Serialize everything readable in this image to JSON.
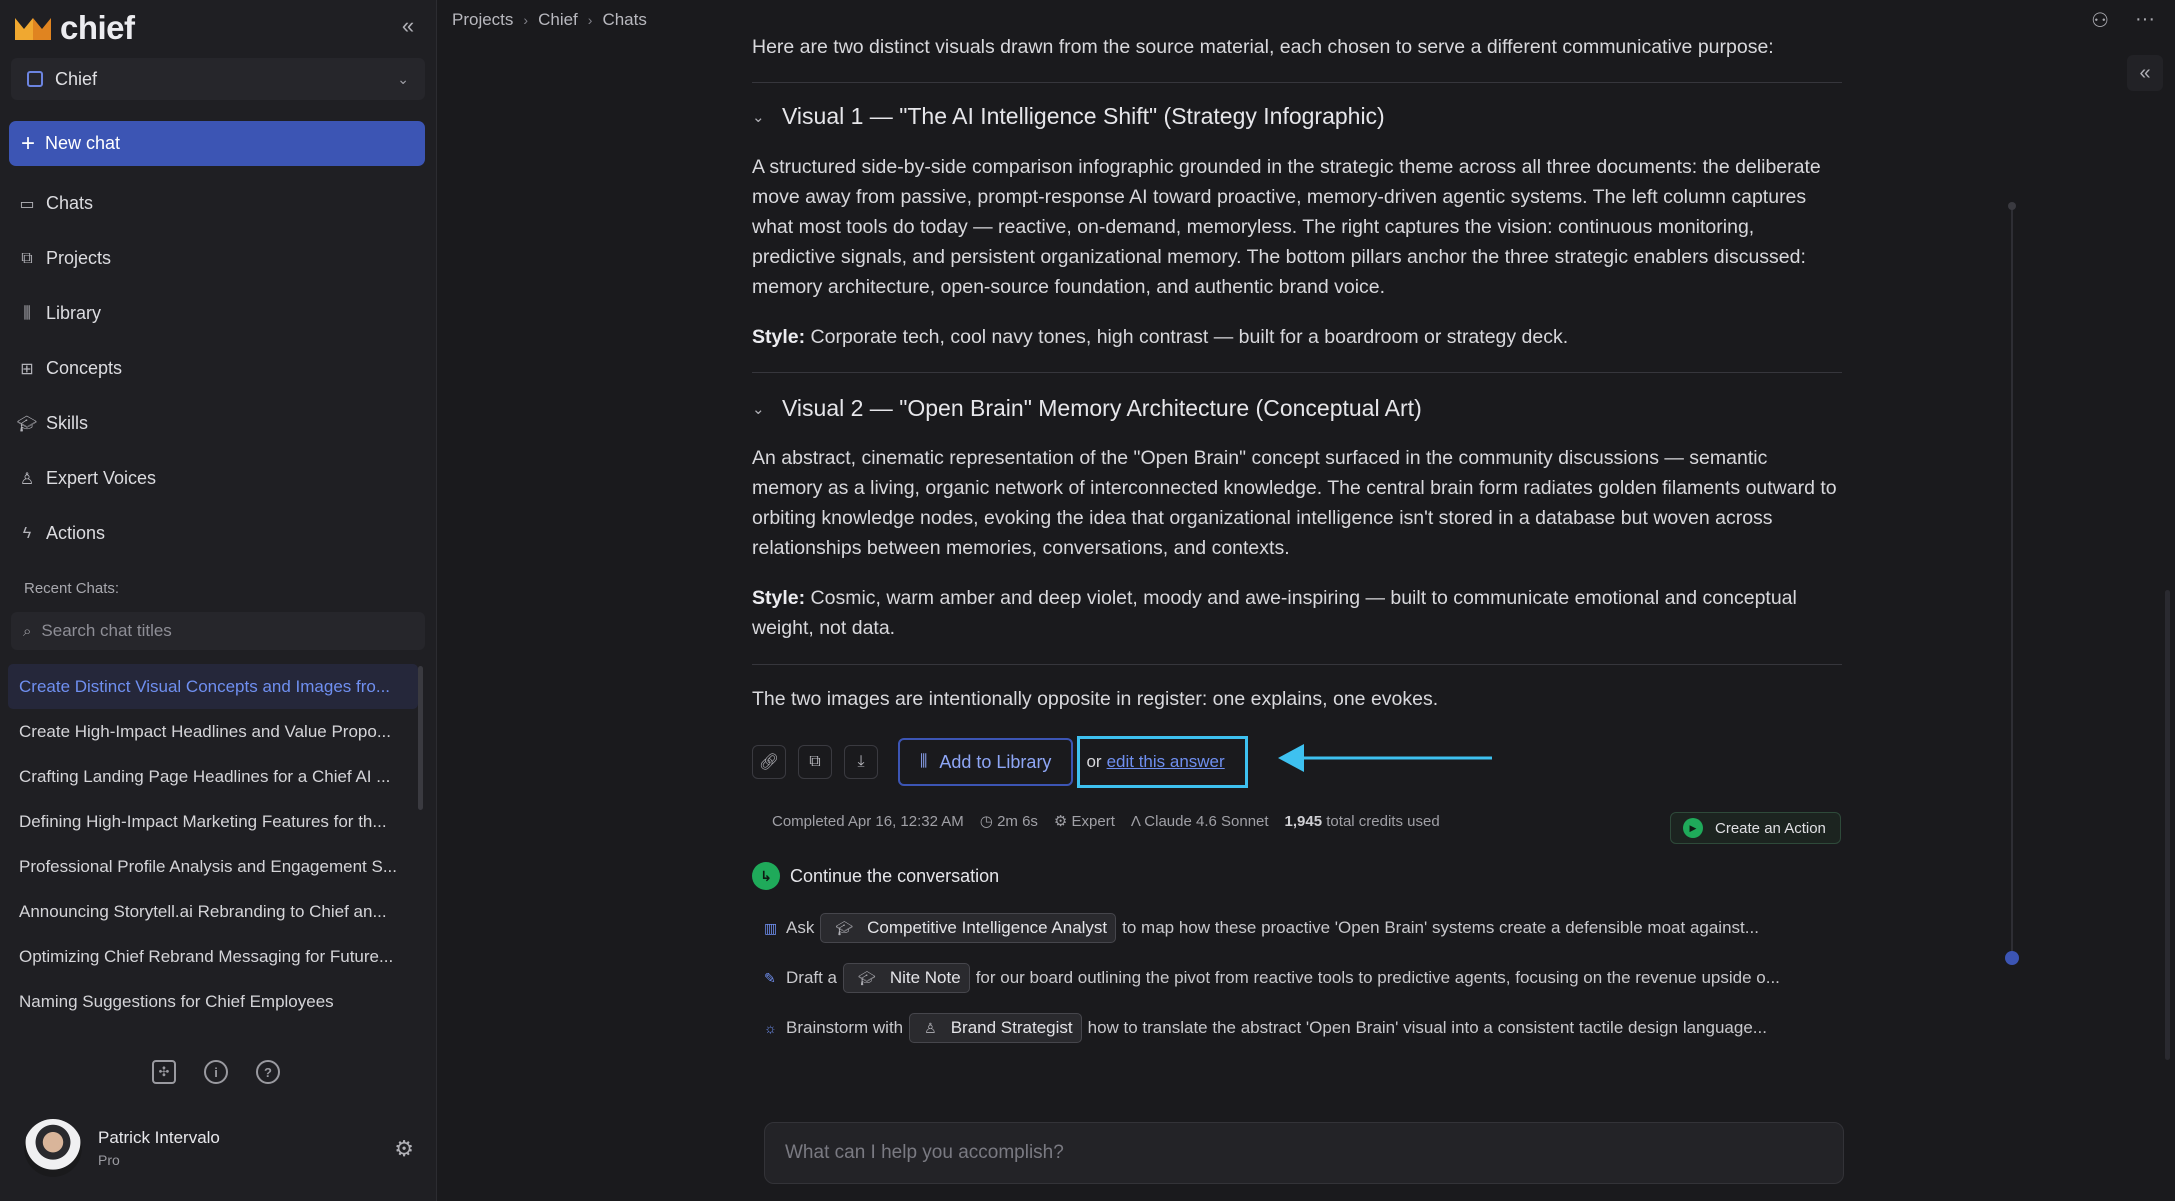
{
  "app": {
    "name": "chief",
    "workspace": "Chief"
  },
  "sidebar": {
    "new_chat": "New chat",
    "nav": [
      {
        "label": "Chats",
        "icon": "chat-icon"
      },
      {
        "label": "Projects",
        "icon": "projects-icon"
      },
      {
        "label": "Library",
        "icon": "library-icon"
      },
      {
        "label": "Concepts",
        "icon": "concepts-icon"
      },
      {
        "label": "Skills",
        "icon": "skills-icon"
      },
      {
        "label": "Expert Voices",
        "icon": "person-icon"
      },
      {
        "label": "Actions",
        "icon": "bolt-icon"
      }
    ],
    "recent_label": "Recent Chats:",
    "search_placeholder": "Search chat titles",
    "recent": [
      "Create Distinct Visual Concepts and Images fro...",
      "Create High-Impact Headlines and Value Propo...",
      "Crafting Landing Page Headlines for a Chief AI ...",
      "Defining High-Impact Marketing Features for th...",
      "Professional Profile Analysis and Engagement S...",
      "Announcing Storytell.ai Rebranding to Chief an...",
      "Optimizing Chief Rebrand Messaging for Future...",
      "Naming Suggestions for Chief Employees"
    ],
    "user": {
      "name": "Patrick Intervalo",
      "plan": "Pro"
    }
  },
  "breadcrumb": [
    "Projects",
    "Chief",
    "Chats"
  ],
  "content": {
    "intro": "Here are two distinct visuals drawn from the source material, each chosen to serve a different communicative purpose:",
    "visual1": {
      "title": "Visual 1 — \"The AI Intelligence Shift\" (Strategy Infographic)",
      "body": "A structured side-by-side comparison infographic grounded in the strategic theme across all three documents: the deliberate move away from passive, prompt-response AI toward proactive, memory-driven agentic systems. The left column captures what most tools do today — reactive, on-demand, memoryless. The right captures the vision: continuous monitoring, predictive signals, and persistent organizational memory. The bottom pillars anchor the three strategic enablers discussed: memory architecture, open-source foundation, and authentic brand voice.",
      "style_label": "Style:",
      "style": "Corporate tech, cool navy tones, high contrast — built for a boardroom or strategy deck."
    },
    "visual2": {
      "title": "Visual 2 — \"Open Brain\" Memory Architecture (Conceptual Art)",
      "body": "An abstract, cinematic representation of the \"Open Brain\" concept surfaced in the community discussions — semantic memory as a living, organic network of interconnected knowledge. The central brain form radiates golden filaments outward to orbiting knowledge nodes, evoking the idea that organizational intelligence isn't stored in a database but woven across relationships between memories, conversations, and contexts.",
      "style_label": "Style:",
      "style": "Cosmic, warm amber and deep violet, moody and awe-inspiring — built to communicate emotional and conceptual weight, not data."
    },
    "closing": "The two images are intentionally opposite in register: one explains, one evokes.",
    "add_to_library": "Add to Library",
    "or_text": "or",
    "edit_link": "edit this answer",
    "meta": {
      "completed": "Completed Apr 16, 12:32 AM",
      "duration": "2m 6s",
      "mode": "Expert",
      "model": "Claude 4.6 Sonnet",
      "credits_num": "1,945",
      "credits_text": "total credits used"
    },
    "create_action": "Create an Action",
    "continue": "Continue the conversation",
    "suggestions": [
      {
        "prefix": "Ask",
        "pill": "Competitive Intelligence Analyst",
        "rest": "to map how these proactive 'Open Brain' systems create a defensible moat against..."
      },
      {
        "prefix": "Draft a",
        "pill": "Nite Note",
        "rest": "for our board outlining the pivot from reactive tools to predictive agents, focusing on the revenue upside o..."
      },
      {
        "prefix": "Brainstorm with",
        "pill": "Brand Strategist",
        "rest": "how to translate the abstract 'Open Brain' visual into a consistent tactile design language..."
      }
    ],
    "composer_placeholder": "What can I help you accomplish?"
  },
  "colors": {
    "accent": "#3c55b4",
    "highlight": "#3ec1f0",
    "success": "#1faa5a"
  }
}
